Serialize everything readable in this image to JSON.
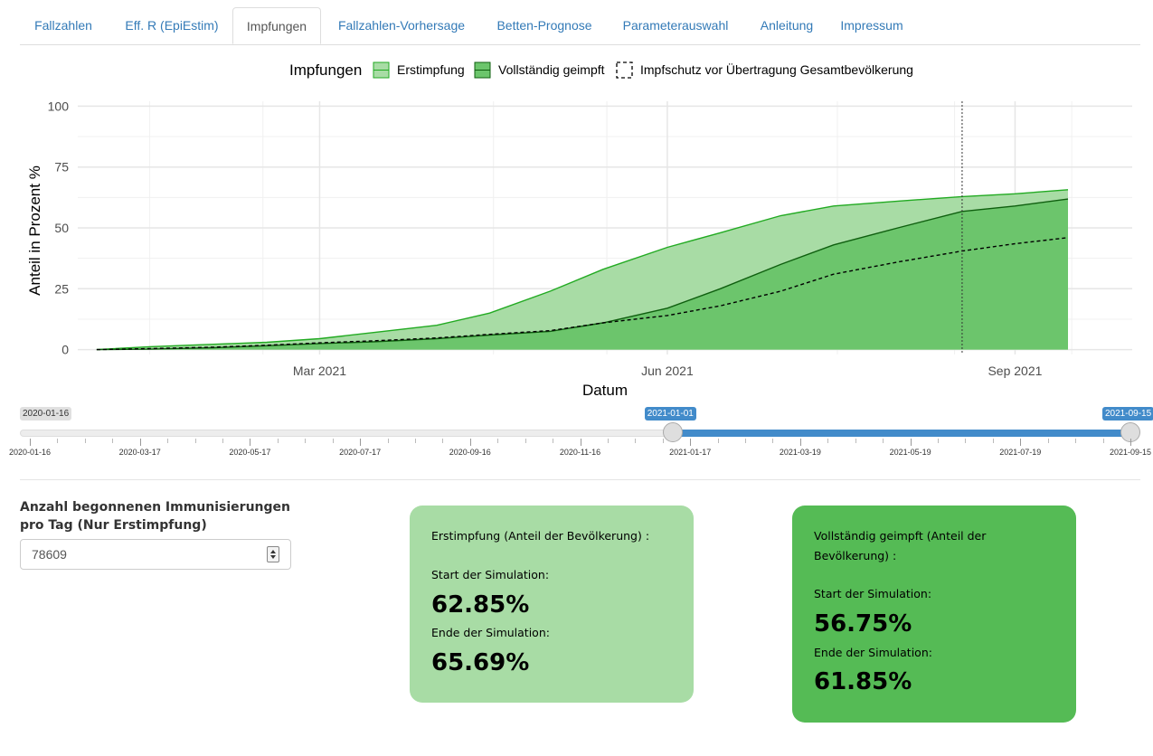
{
  "tabs": [
    {
      "label": "Fallzahlen",
      "active": false
    },
    {
      "label": "Eff. R (EpiEstim)",
      "active": false
    },
    {
      "label": "Impfungen",
      "active": true
    },
    {
      "label": "Fallzahlen-Vorhersage",
      "active": false
    },
    {
      "label": "Betten-Prognose",
      "active": false
    },
    {
      "label": "Parameterauswahl",
      "active": false
    },
    {
      "label": "Anleitung",
      "active": false
    },
    {
      "label": "Impressum",
      "active": false
    }
  ],
  "colors": {
    "first_fill": "#a8dca5",
    "first_line": "#22aa22",
    "full_fill": "#6cc56c",
    "full_line": "#0f5f0f",
    "accent": "#428bca",
    "card_first": "#a8dca5",
    "card_full": "#55bb55"
  },
  "chart_data": {
    "type": "area",
    "legend_title": "Impfungen",
    "legend_position": "top",
    "xlabel": "Datum",
    "ylabel": "Anteil in Prozent %",
    "xlim": [
      "2020-12-27",
      "2021-10-02"
    ],
    "ylim": [
      -2,
      102
    ],
    "x_ticks": [
      {
        "date": "2021-03-01",
        "label": "Mar 2021"
      },
      {
        "date": "2021-06-01",
        "label": "Jun 2021"
      },
      {
        "date": "2021-09-01",
        "label": "Sep 2021"
      }
    ],
    "y_ticks": [
      0,
      25,
      50,
      75,
      100
    ],
    "grid": true,
    "vline": "2021-08-18",
    "series": [
      {
        "name": "Erstimpfung",
        "style": "area",
        "x": [
          "2021-01-01",
          "2021-01-15",
          "2021-02-01",
          "2021-02-15",
          "2021-03-01",
          "2021-03-15",
          "2021-04-01",
          "2021-04-15",
          "2021-05-01",
          "2021-05-15",
          "2021-06-01",
          "2021-06-15",
          "2021-07-01",
          "2021-07-15",
          "2021-08-01",
          "2021-08-18",
          "2021-09-01",
          "2021-09-15"
        ],
        "values": [
          0,
          1.2,
          2.2,
          3,
          4.5,
          7,
          10,
          15,
          24,
          33,
          42,
          48,
          55,
          59,
          61,
          62.85,
          64,
          65.69
        ]
      },
      {
        "name": "Vollständig geimpft",
        "style": "area",
        "x": [
          "2021-01-01",
          "2021-01-15",
          "2021-02-01",
          "2021-02-15",
          "2021-03-01",
          "2021-03-15",
          "2021-04-01",
          "2021-04-15",
          "2021-05-01",
          "2021-05-15",
          "2021-06-01",
          "2021-06-15",
          "2021-07-01",
          "2021-07-15",
          "2021-08-01",
          "2021-08-18",
          "2021-09-01",
          "2021-09-15"
        ],
        "values": [
          0,
          0.2,
          0.8,
          1.6,
          2.5,
          3.2,
          4.5,
          6,
          7.5,
          11,
          17,
          25,
          35,
          43,
          50,
          56.75,
          59,
          61.85
        ]
      },
      {
        "name": "Impfschutz vor Übertragung Gesamtbevölkerung",
        "style": "dashed",
        "x": [
          "2021-01-01",
          "2021-01-15",
          "2021-02-01",
          "2021-02-15",
          "2021-03-01",
          "2021-03-15",
          "2021-04-01",
          "2021-04-15",
          "2021-05-01",
          "2021-05-15",
          "2021-06-01",
          "2021-06-15",
          "2021-07-01",
          "2021-07-15",
          "2021-08-01",
          "2021-08-18",
          "2021-09-01",
          "2021-09-15"
        ],
        "values": [
          0,
          0.4,
          1,
          1.8,
          2.8,
          3.6,
          4.8,
          6.3,
          7.8,
          11,
          14,
          18,
          24,
          31,
          36,
          40.5,
          43.5,
          46
        ]
      }
    ]
  },
  "slider": {
    "min_label": "2020-01-16",
    "from_label": "2021-01-01",
    "to_label": "2021-09-15",
    "from_fraction": 0.5833,
    "to_fraction": 1.0,
    "tick_labels": [
      "2020-01-16",
      "2020-03-17",
      "2020-05-17",
      "2020-07-17",
      "2020-09-16",
      "2020-11-16",
      "2021-01-17",
      "2021-03-19",
      "2021-05-19",
      "2021-07-19",
      "2021-09-15"
    ]
  },
  "input": {
    "label": "Anzahl begonnenen Immunisierungen pro Tag (Nur Erstimpfung)",
    "value": "78609"
  },
  "card_first": {
    "header": "Erstimpfung (Anteil der Bevölkerung) :",
    "start_label": "Start der Simulation:",
    "start_value": "62.85%",
    "end_label": "Ende der Simulation:",
    "end_value": "65.69%"
  },
  "card_full": {
    "header": "Vollständig geimpft (Anteil der Bevölkerung) :",
    "start_label": "Start der Simulation:",
    "start_value": "56.75%",
    "end_label": "Ende der Simulation:",
    "end_value": "61.85%"
  }
}
